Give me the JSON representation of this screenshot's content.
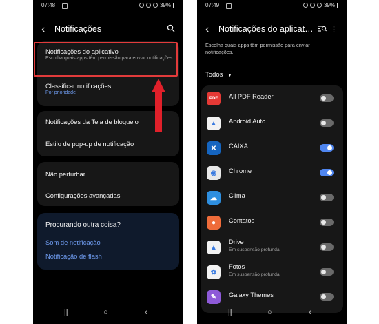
{
  "left": {
    "status": {
      "time": "07:48",
      "battery": "39%"
    },
    "header": {
      "title": "Notificações"
    },
    "group1": [
      {
        "title": "Notificações do aplicativo",
        "subtitle": "Escolha quais apps têm permissão para enviar notificações"
      },
      {
        "title": "Classificar notificações",
        "subtitle": "Por prioridade"
      }
    ],
    "group2": [
      {
        "title": "Notificações da Tela de bloqueio"
      },
      {
        "title": "Estilo de pop-up de notificação"
      }
    ],
    "group3": [
      {
        "title": "Não perturbar"
      },
      {
        "title": "Configurações avançadas"
      }
    ],
    "suggest": {
      "heading": "Procurando outra coisa?",
      "links": [
        "Som de notificação",
        "Notificação de flash"
      ]
    }
  },
  "right": {
    "status": {
      "time": "07:49",
      "battery": "39%"
    },
    "header": {
      "title": "Notificações do aplicat…"
    },
    "description": "Escolha quais apps têm permissão para enviar notificações.",
    "filter": "Todos",
    "apps": [
      {
        "name": "All PDF Reader",
        "subtitle": "",
        "enabled": false,
        "icon": "pdf-icon",
        "color": "#e53935",
        "glyph": "PDF"
      },
      {
        "name": "Android Auto",
        "subtitle": "",
        "enabled": false,
        "icon": "android-auto-icon",
        "color": "#f2f2f2",
        "glyph": "▲"
      },
      {
        "name": "CAIXA",
        "subtitle": "",
        "enabled": true,
        "icon": "caixa-icon",
        "color": "#1565c0",
        "glyph": "✕"
      },
      {
        "name": "Chrome",
        "subtitle": "",
        "enabled": true,
        "icon": "chrome-icon",
        "color": "#e8e8e8",
        "glyph": "◉"
      },
      {
        "name": "Clima",
        "subtitle": "",
        "enabled": false,
        "icon": "weather-icon",
        "color": "#2e8fe0",
        "glyph": "☁"
      },
      {
        "name": "Contatos",
        "subtitle": "",
        "enabled": false,
        "icon": "contacts-icon",
        "color": "#ef6c3a",
        "glyph": "●"
      },
      {
        "name": "Drive",
        "subtitle": "Em suspensão profunda",
        "enabled": false,
        "icon": "drive-icon",
        "color": "#f2f2f2",
        "glyph": "▲"
      },
      {
        "name": "Fotos",
        "subtitle": "Em suspensão profunda",
        "enabled": false,
        "icon": "photos-icon",
        "color": "#f2f2f2",
        "glyph": "✿"
      },
      {
        "name": "Galaxy Themes",
        "subtitle": "",
        "enabled": false,
        "icon": "themes-icon",
        "color": "#8e5ad8",
        "glyph": "✎"
      }
    ]
  }
}
